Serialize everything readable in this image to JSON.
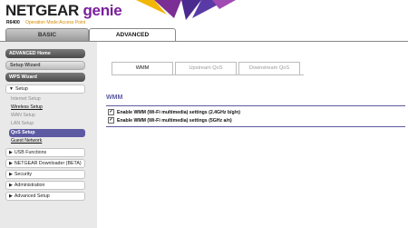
{
  "header": {
    "brand": "NETGEAR",
    "product": "genie",
    "model": "R6400",
    "mode": "Operation Mode:Access Point"
  },
  "main_tabs": [
    {
      "label": "BASIC"
    },
    {
      "label": "ADVANCED"
    }
  ],
  "sidebar": {
    "advanced_home": "ADVANCED Home",
    "setup_wizard": "Setup Wizard",
    "wps_wizard": "WPS Wizard",
    "setup_section": "Setup",
    "setup_items": [
      {
        "label": "Internet Setup"
      },
      {
        "label": "Wireless Setup"
      },
      {
        "label": "WAN Setup"
      },
      {
        "label": "LAN Setup"
      },
      {
        "label": "QoS Setup"
      },
      {
        "label": "Guest Network"
      }
    ],
    "sections": [
      {
        "label": "USB Functions"
      },
      {
        "label": "NETGEAR Downloader (BETA)"
      },
      {
        "label": "Security"
      },
      {
        "label": "Administration"
      },
      {
        "label": "Advanced Setup"
      }
    ]
  },
  "content": {
    "tabs": [
      {
        "label": "WMM"
      },
      {
        "label": "Upstream QoS"
      },
      {
        "label": "Downstream QoS"
      }
    ],
    "section_title": "WMM",
    "options": [
      {
        "label": "Enable WMM (Wi-Fi multimedia) settings (2.4GHz b/g/n)",
        "checked": true
      },
      {
        "label": "Enable WMM (Wi-Fi multimedia) settings (5GHz a/n)",
        "checked": true
      }
    ]
  },
  "colors": {
    "accent": "#5c5aa3",
    "genie": "#7a1f9a",
    "mode_text": "#d48a00"
  }
}
